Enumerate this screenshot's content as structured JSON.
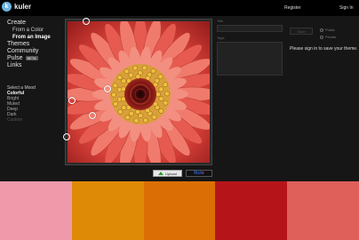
{
  "header": {
    "logo_letter": "k",
    "logo_text": "kuler",
    "register_label": "Register",
    "signin_label": "Sign In"
  },
  "nav": {
    "create": "Create",
    "from_color": "From a Color",
    "from_image": "From an Image",
    "themes": "Themes",
    "community": "Community",
    "pulse": "Pulse",
    "pulse_badge": "BETA",
    "links": "Links"
  },
  "mood": {
    "title": "Select a Mood",
    "options": [
      "Colorful",
      "Bright",
      "Muted",
      "Deep",
      "Dark",
      "Custom"
    ]
  },
  "actions": {
    "upload_label": "Upload",
    "flickr_blue": "flick",
    "flickr_pink": "r"
  },
  "theme_form": {
    "title_label": "Title",
    "tags_label": "Tags",
    "save_label": "Save",
    "public_label": "Public",
    "private_label": "Private",
    "signin_message": "Please sign in to save your theme."
  },
  "swatches": [
    "#ef99aa",
    "#de8a07",
    "#db6f05",
    "#b51519",
    "#df5f5a"
  ]
}
